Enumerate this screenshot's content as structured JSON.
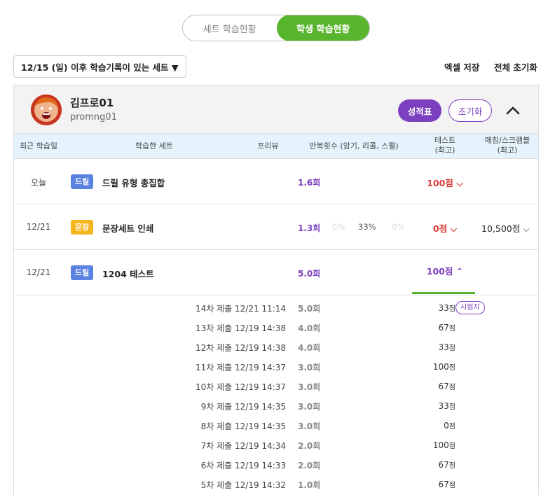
{
  "tabs": [
    {
      "label": "세트 학습현황",
      "active": false
    },
    {
      "label": "학생 학습현황",
      "active": true
    }
  ],
  "filter": {
    "label": "12/15 (일) 이후 학습기록이 있는 세트 ▼"
  },
  "actions": {
    "excel": "엑셀 저장",
    "reset_all": "전체 초기화"
  },
  "student": {
    "name": "김프로01",
    "id": "promng01",
    "grade_button": "성적표",
    "reset_button": "초기화"
  },
  "columns": {
    "recent": "최근 학습일",
    "set": "학습한 세트",
    "preview": "프리뷰",
    "repeat": "반복횟수 (암기, 리콜, 스펠)",
    "test_1": "테스트",
    "test_2": "(최고)",
    "match_1": "매칭/스크램블",
    "match_2": "(최고)"
  },
  "rows": [
    {
      "date": "오늘",
      "type": "드릴",
      "name": "드릴 유형 총집합",
      "repeat": "1.6회",
      "test": "100점 ⌵",
      "match": ""
    },
    {
      "date": "12/21",
      "type": "문장",
      "name": "문장세트 인쇄",
      "repeat": "1.3회",
      "sub1": "0%",
      "sub2": "33%",
      "sub3": "0%",
      "test": "0점 ⌵",
      "match": "10,500점 ⌵"
    },
    {
      "date": "12/21",
      "type": "드릴",
      "name": "1204 테스트",
      "repeat": "5.0회",
      "test": "100점 ⌃",
      "match": ""
    }
  ],
  "history": [
    {
      "label": "14차 제출 12/21 11:14",
      "repeat": "5.0회",
      "score": "33",
      "tag": "시험지"
    },
    {
      "label": "13차 제출 12/19 14:38",
      "repeat": "4.0회",
      "score": "67"
    },
    {
      "label": "12차 제출 12/19 14:38",
      "repeat": "4.0회",
      "score": "33"
    },
    {
      "label": "11차 제출 12/19 14:37",
      "repeat": "3.0회",
      "score": "100"
    },
    {
      "label": "10차 제출 12/19 14:37",
      "repeat": "3.0회",
      "score": "67"
    },
    {
      "label": "9차 제출 12/19 14:35",
      "repeat": "3.0회",
      "score": "33"
    },
    {
      "label": "8차 제출 12/19 14:35",
      "repeat": "3.0회",
      "score": "0"
    },
    {
      "label": "7차 제출 12/19 14:34",
      "repeat": "2.0회",
      "score": "100"
    },
    {
      "label": "6차 제출 12/19 14:33",
      "repeat": "2.0회",
      "score": "67"
    },
    {
      "label": "5차 제출 12/19 14:32",
      "repeat": "1.0회",
      "score": "67"
    }
  ],
  "score_unit": "점",
  "colors": {
    "green": "#5ab52e",
    "purple": "#7b3fbf",
    "red": "#d93a36",
    "drill": "#5a82e0",
    "sentence": "#f5b51f"
  }
}
